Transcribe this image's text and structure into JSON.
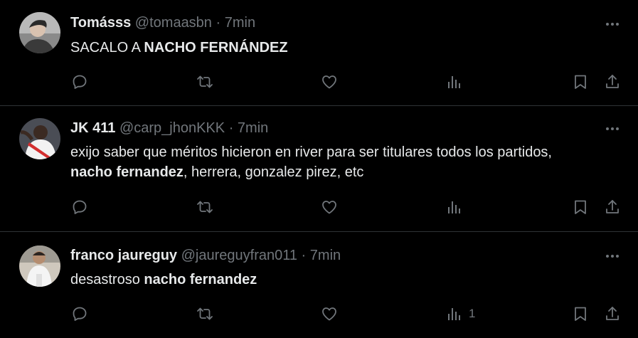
{
  "tweets": [
    {
      "name": "Tomásss",
      "handle": "@tomaasbn",
      "time": "7min",
      "text_plain": "SACALO A ",
      "text_bold": "NACHO FERNÁNDEZ",
      "text_after": "",
      "views_count": ""
    },
    {
      "name": "JK 411",
      "handle": "@carp_jhonKKK",
      "time": "7min",
      "text_plain": "exijo saber que méritos hicieron en river para ser titulares todos los partidos, ",
      "text_bold": "nacho fernandez",
      "text_after": ", herrera, gonzalez pirez, etc",
      "views_count": ""
    },
    {
      "name": "franco jaureguy",
      "handle": "@jaureguyfran011",
      "time": "7min",
      "text_plain": "desastroso ",
      "text_bold": "nacho fernandez",
      "text_after": "",
      "views_count": "1"
    }
  ],
  "separator": "·",
  "icons": {
    "reply": "reply-icon",
    "retweet": "retweet-icon",
    "like": "heart-icon",
    "views": "views-icon",
    "bookmark": "bookmark-icon",
    "share": "share-icon",
    "more": "more-icon"
  },
  "colors": {
    "background": "#000000",
    "text": "#e7e9ea",
    "secondary": "#71767b",
    "divider": "#2f3336"
  }
}
